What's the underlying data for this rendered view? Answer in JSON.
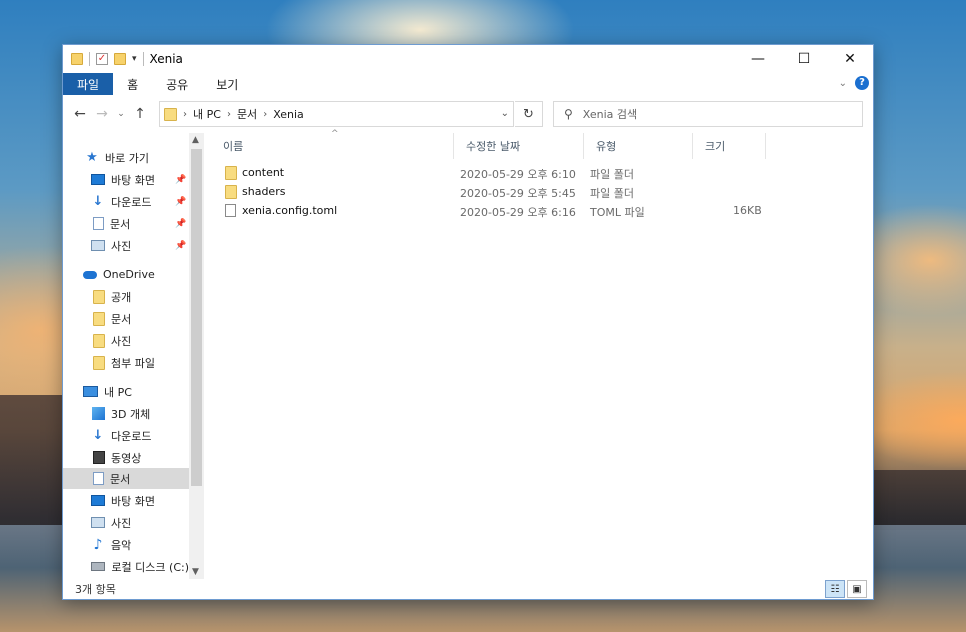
{
  "window": {
    "title": "Xenia",
    "controls": {
      "minimize": "—",
      "maximize": "☐",
      "close": "✕"
    }
  },
  "ribbon": {
    "tabs": [
      "파일",
      "홈",
      "공유",
      "보기"
    ],
    "help": "?"
  },
  "navbar": {
    "back": "←",
    "forward": "→",
    "recent": "⌄",
    "up": "↑",
    "breadcrumb": [
      "내 PC",
      "문서",
      "Xenia"
    ],
    "refresh": "↻",
    "search_placeholder": "Xenia 검색"
  },
  "sidebar": {
    "items": [
      {
        "label": "바로 가기",
        "icon": "star-icon"
      },
      {
        "label": "바탕 화면",
        "icon": "desktop-icon",
        "pinned": true
      },
      {
        "label": "다운로드",
        "icon": "download-icon",
        "pinned": true
      },
      {
        "label": "문서",
        "icon": "document-icon",
        "pinned": true
      },
      {
        "label": "사진",
        "icon": "pictures-icon",
        "pinned": true
      },
      {
        "label": "OneDrive",
        "icon": "onedrive-cloud-icon"
      },
      {
        "label": "공개",
        "icon": "folder-icon"
      },
      {
        "label": "문서",
        "icon": "folder-icon"
      },
      {
        "label": "사진",
        "icon": "folder-icon"
      },
      {
        "label": "첨부 파일",
        "icon": "folder-icon"
      },
      {
        "label": "내 PC",
        "icon": "this-pc-icon"
      },
      {
        "label": "3D 개체",
        "icon": "3d-objects-icon"
      },
      {
        "label": "다운로드",
        "icon": "download-icon"
      },
      {
        "label": "동영상",
        "icon": "video-icon"
      },
      {
        "label": "문서",
        "icon": "document-icon",
        "selected": true
      },
      {
        "label": "바탕 화면",
        "icon": "desktop-icon"
      },
      {
        "label": "사진",
        "icon": "pictures-icon"
      },
      {
        "label": "음악",
        "icon": "music-icon"
      },
      {
        "label": "로컬 디스크 (C:)",
        "icon": "drive-icon"
      }
    ]
  },
  "columns": [
    "이름",
    "수정한 날짜",
    "유형",
    "크기"
  ],
  "files": [
    {
      "name": "content",
      "modified": "2020-05-29 오후 6:10",
      "type": "파일 폴더",
      "size": "",
      "kind": "folder"
    },
    {
      "name": "shaders",
      "modified": "2020-05-29 오후 5:45",
      "type": "파일 폴더",
      "size": "",
      "kind": "folder"
    },
    {
      "name": "xenia.config.toml",
      "modified": "2020-05-29 오후 6:16",
      "type": "TOML 파일",
      "size": "16KB",
      "kind": "file"
    }
  ],
  "status": {
    "item_count": "3개 항목"
  }
}
